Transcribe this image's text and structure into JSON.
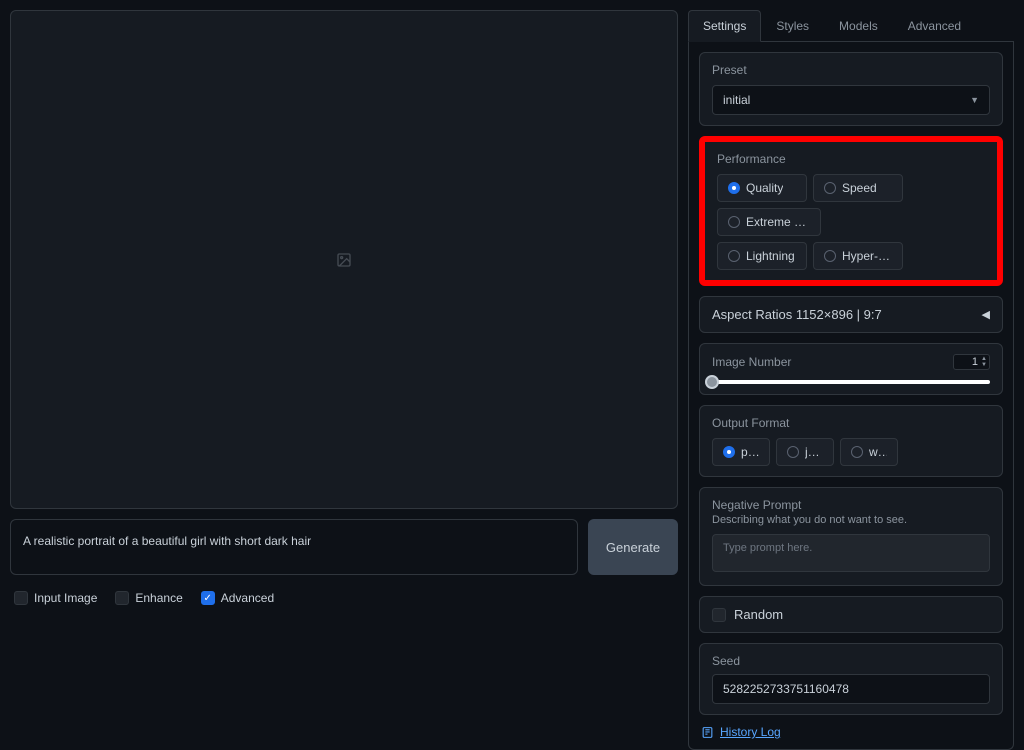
{
  "prompt": {
    "value": "A realistic portrait of a beautiful girl with short dark hair",
    "generate_label": "Generate"
  },
  "bottom_checkboxes": {
    "input_image": {
      "label": "Input Image",
      "checked": false
    },
    "enhance": {
      "label": "Enhance",
      "checked": false
    },
    "advanced": {
      "label": "Advanced",
      "checked": true
    }
  },
  "tabs": {
    "settings": "Settings",
    "styles": "Styles",
    "models": "Models",
    "advanced": "Advanced",
    "active": "settings"
  },
  "preset": {
    "label": "Preset",
    "value": "initial"
  },
  "performance": {
    "label": "Performance",
    "options": [
      "Quality",
      "Speed",
      "Extreme Speed",
      "Lightning",
      "Hyper-SD"
    ],
    "selected": "Quality"
  },
  "aspect": {
    "label": "Aspect Ratios 1152×896 | 9:7"
  },
  "image_number": {
    "label": "Image Number",
    "value": "1"
  },
  "output_format": {
    "label": "Output Format",
    "options": [
      "png",
      "jpeg",
      "webp"
    ],
    "selected": "png"
  },
  "negative_prompt": {
    "label": "Negative Prompt",
    "description": "Describing what you do not want to see.",
    "placeholder": "Type prompt here."
  },
  "random": {
    "label": "Random",
    "checked": false
  },
  "seed": {
    "label": "Seed",
    "value": "5282252733751160478"
  },
  "history_link": "History Log"
}
